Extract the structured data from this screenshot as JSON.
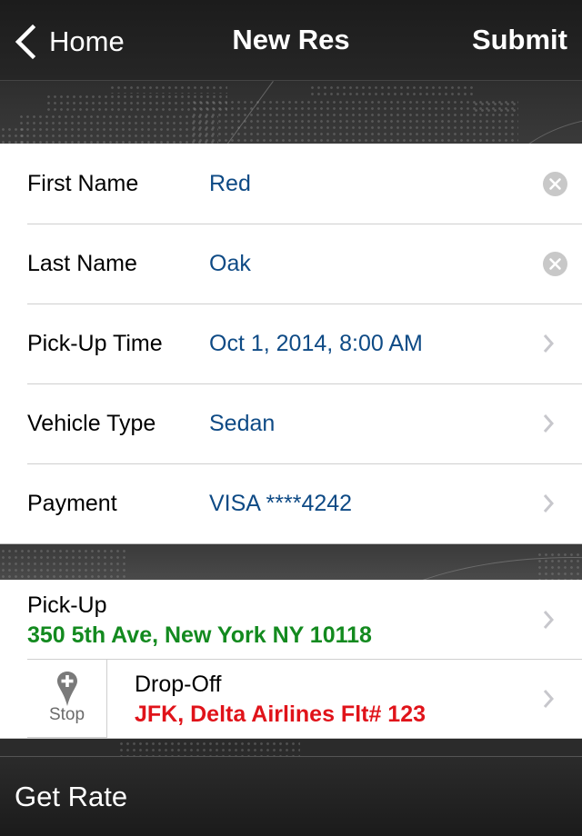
{
  "nav": {
    "back_label": "Home",
    "title": "New Res",
    "submit_label": "Submit"
  },
  "form": {
    "rows": [
      {
        "label": "First Name",
        "value": "Red",
        "accessory": "clear"
      },
      {
        "label": "Last Name",
        "value": "Oak",
        "accessory": "clear"
      },
      {
        "label": "Pick-Up Time",
        "value": "Oct 1, 2014, 8:00 AM",
        "accessory": "chevron"
      },
      {
        "label": "Vehicle Type",
        "value": "Sedan",
        "accessory": "chevron"
      },
      {
        "label": "Payment",
        "value": "VISA ****4242",
        "accessory": "chevron"
      }
    ]
  },
  "locations": {
    "pickup": {
      "title": "Pick-Up",
      "address": "350 5th Ave, New York NY 10118",
      "color": "#138a1f"
    },
    "dropoff": {
      "title": "Drop-Off",
      "address": "JFK, Delta Airlines Flt# 123",
      "color": "#e0131a"
    },
    "stop_label": "Stop"
  },
  "footer": {
    "get_rate_label": "Get Rate"
  },
  "colors": {
    "value_text": "#0e4a85",
    "pickup_green": "#138a1f",
    "dropoff_red": "#e0131a"
  }
}
